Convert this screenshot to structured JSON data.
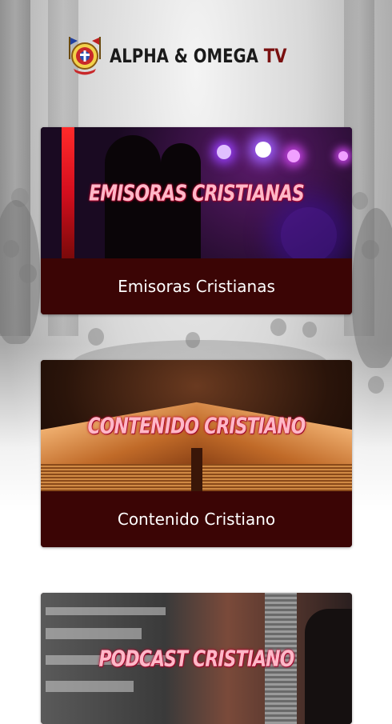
{
  "header": {
    "brand_main": "ALPHA & OMEGA",
    "brand_tv": "TV"
  },
  "cards": [
    {
      "overlay": "EMISORAS CRISTIANAS",
      "label": "Emisoras Cristianas"
    },
    {
      "overlay": "CONTENIDO CRISTIANO",
      "label": "Contenido Cristiano"
    },
    {
      "overlay": "PODCAST CRISTIANO",
      "label": ""
    }
  ],
  "colors": {
    "caption_bg": "#3b0505",
    "overlay_text": "#ffb8c8",
    "brand_text": "#1a1a1a"
  }
}
